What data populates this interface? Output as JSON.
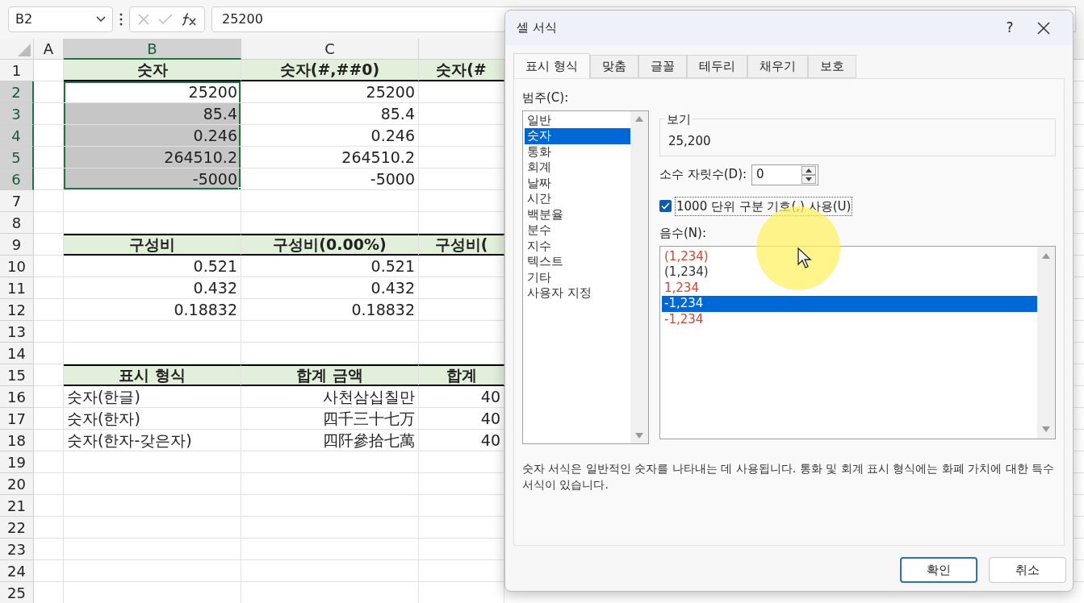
{
  "formula_bar": {
    "name_box": "B2",
    "value": "25200"
  },
  "sheet": {
    "columns": [
      {
        "label": "A",
        "selected": false
      },
      {
        "label": "B",
        "selected": true
      },
      {
        "label": "C",
        "selected": false
      }
    ],
    "rows": [
      {
        "n": "1",
        "selected": false,
        "kind": "header",
        "cells": {
          "B": {
            "text": "숫자",
            "selected": false,
            "active": false
          },
          "C": {
            "text": "숫자(#,##0)",
            "selected": false,
            "active": false
          },
          "D": {
            "text": "숫자(#",
            "selected": false,
            "active": false
          }
        }
      },
      {
        "n": "2",
        "selected": true,
        "kind": "data",
        "cells": {
          "B": {
            "text": "25200",
            "kind": "number",
            "selected": true,
            "active": true
          },
          "C": {
            "text": "25200",
            "kind": "number",
            "selected": false,
            "active": false
          }
        }
      },
      {
        "n": "3",
        "selected": true,
        "kind": "data",
        "cells": {
          "B": {
            "text": "85.4",
            "kind": "number",
            "selected": true,
            "active": false
          },
          "C": {
            "text": "85.4",
            "kind": "number",
            "selected": false,
            "active": false
          }
        }
      },
      {
        "n": "4",
        "selected": true,
        "kind": "data",
        "cells": {
          "B": {
            "text": "0.246",
            "kind": "number",
            "selected": true,
            "active": false
          },
          "C": {
            "text": "0.246",
            "kind": "number",
            "selected": false,
            "active": false
          }
        }
      },
      {
        "n": "5",
        "selected": true,
        "kind": "data",
        "cells": {
          "B": {
            "text": "264510.2",
            "kind": "number",
            "selected": true,
            "active": false
          },
          "C": {
            "text": "264510.2",
            "kind": "number",
            "selected": false,
            "active": false
          }
        }
      },
      {
        "n": "6",
        "selected": true,
        "kind": "data",
        "cells": {
          "B": {
            "text": "-5000",
            "kind": "number",
            "selected": true,
            "active": false
          },
          "C": {
            "text": "-5000",
            "kind": "number",
            "selected": false,
            "active": false
          }
        }
      },
      {
        "n": "7",
        "selected": false,
        "kind": "data"
      },
      {
        "n": "8",
        "selected": false,
        "kind": "data"
      },
      {
        "n": "9",
        "selected": false,
        "kind": "header",
        "cells": {
          "B": {
            "text": "구성비",
            "selected": false,
            "active": false
          },
          "C": {
            "text": "구성비(0.00%)",
            "selected": false,
            "active": false
          },
          "D": {
            "text": "구성비(",
            "selected": false,
            "active": false
          }
        }
      },
      {
        "n": "10",
        "selected": false,
        "kind": "data",
        "cells": {
          "B": {
            "text": "0.521",
            "kind": "number",
            "selected": false,
            "active": false
          },
          "C": {
            "text": "0.521",
            "kind": "number",
            "selected": false,
            "active": false
          }
        }
      },
      {
        "n": "11",
        "selected": false,
        "kind": "data",
        "cells": {
          "B": {
            "text": "0.432",
            "kind": "number",
            "selected": false,
            "active": false
          },
          "C": {
            "text": "0.432",
            "kind": "number",
            "selected": false,
            "active": false
          }
        }
      },
      {
        "n": "12",
        "selected": false,
        "kind": "data",
        "cells": {
          "B": {
            "text": "0.18832",
            "kind": "number",
            "selected": false,
            "active": false
          },
          "C": {
            "text": "0.18832",
            "kind": "number",
            "selected": false,
            "active": false
          }
        }
      },
      {
        "n": "13",
        "selected": false,
        "kind": "data"
      },
      {
        "n": "14",
        "selected": false,
        "kind": "data"
      },
      {
        "n": "15",
        "selected": false,
        "kind": "header",
        "cells": {
          "B": {
            "text": "표시 형식",
            "selected": false,
            "active": false
          },
          "C": {
            "text": "합계 금액",
            "selected": false,
            "active": false
          },
          "D": {
            "text": "합계",
            "selected": false,
            "active": false
          }
        }
      },
      {
        "n": "16",
        "selected": false,
        "kind": "data",
        "cells": {
          "B": {
            "text": "숫자(한글)",
            "kind": "text",
            "selected": false,
            "active": false
          },
          "C": {
            "text": "사천삼십칠만",
            "kind": "number",
            "selected": false,
            "active": false
          },
          "D": {
            "text": "40",
            "kind": "number",
            "selected": false,
            "active": false
          }
        }
      },
      {
        "n": "17",
        "selected": false,
        "kind": "data",
        "cells": {
          "B": {
            "text": "숫자(한자)",
            "kind": "text",
            "selected": false,
            "active": false
          },
          "C": {
            "text": "四千三十七万",
            "kind": "number",
            "selected": false,
            "active": false
          },
          "D": {
            "text": "40",
            "kind": "number",
            "selected": false,
            "active": false
          }
        }
      },
      {
        "n": "18",
        "selected": false,
        "kind": "data",
        "cells": {
          "B": {
            "text": "숫자(한자-갖은자)",
            "kind": "text",
            "selected": false,
            "active": false
          },
          "C": {
            "text": "四阡參拾七萬",
            "kind": "number",
            "selected": false,
            "active": false
          },
          "D": {
            "text": "40",
            "kind": "number",
            "selected": false,
            "active": false
          }
        }
      },
      {
        "n": "19",
        "selected": false,
        "kind": "data"
      },
      {
        "n": "20",
        "selected": false,
        "kind": "data"
      },
      {
        "n": "21",
        "selected": false,
        "kind": "data"
      },
      {
        "n": "22",
        "selected": false,
        "kind": "data"
      },
      {
        "n": "23",
        "selected": false,
        "kind": "data"
      },
      {
        "n": "24",
        "selected": false,
        "kind": "data"
      },
      {
        "n": "25",
        "selected": false,
        "kind": "data"
      }
    ]
  },
  "dialog": {
    "title": "셀 서식",
    "help": "?",
    "tabs": [
      {
        "label": "표시 형식",
        "selected": true
      },
      {
        "label": "맞춤",
        "selected": false
      },
      {
        "label": "글꼴",
        "selected": false
      },
      {
        "label": "테두리",
        "selected": false
      },
      {
        "label": "채우기",
        "selected": false
      },
      {
        "label": "보호",
        "selected": false
      }
    ],
    "category_label": "범주(C):",
    "categories": [
      {
        "label": "일반",
        "selected": false
      },
      {
        "label": "숫자",
        "selected": true
      },
      {
        "label": "통화",
        "selected": false
      },
      {
        "label": "회계",
        "selected": false
      },
      {
        "label": "날짜",
        "selected": false
      },
      {
        "label": "시간",
        "selected": false
      },
      {
        "label": "백분율",
        "selected": false
      },
      {
        "label": "분수",
        "selected": false
      },
      {
        "label": "지수",
        "selected": false
      },
      {
        "label": "텍스트",
        "selected": false
      },
      {
        "label": "기타",
        "selected": false
      },
      {
        "label": "사용자 지정",
        "selected": false
      }
    ],
    "preview": {
      "label": "보기",
      "value": "25,200"
    },
    "decimal_places": {
      "label": "소수 자릿수(D):",
      "value": "0"
    },
    "thousands_separator": {
      "label": "1000 단위 구분 기호(,) 사용(U)",
      "checked": true
    },
    "negative_numbers": {
      "label": "음수(N):",
      "options": [
        {
          "text": "(1,234)",
          "color": "#d9432f",
          "selected": false
        },
        {
          "text": "(1,234)",
          "color": "#333333",
          "selected": false
        },
        {
          "text": "1,234",
          "color": "#d9432f",
          "selected": false
        },
        {
          "text": "-1,234",
          "selected": true
        },
        {
          "text": "-1,234",
          "color": "#d9432f",
          "selected": false
        }
      ]
    },
    "description": "숫자 서식은 일반적인 숫자를 나타내는 데 사용됩니다. 통화 및 회계 표시 형식에는 화폐 가치에 대한 특수 서식이 있습니다.",
    "buttons": [
      {
        "label": "확인",
        "default": true
      },
      {
        "label": "취소",
        "default": false
      }
    ]
  }
}
